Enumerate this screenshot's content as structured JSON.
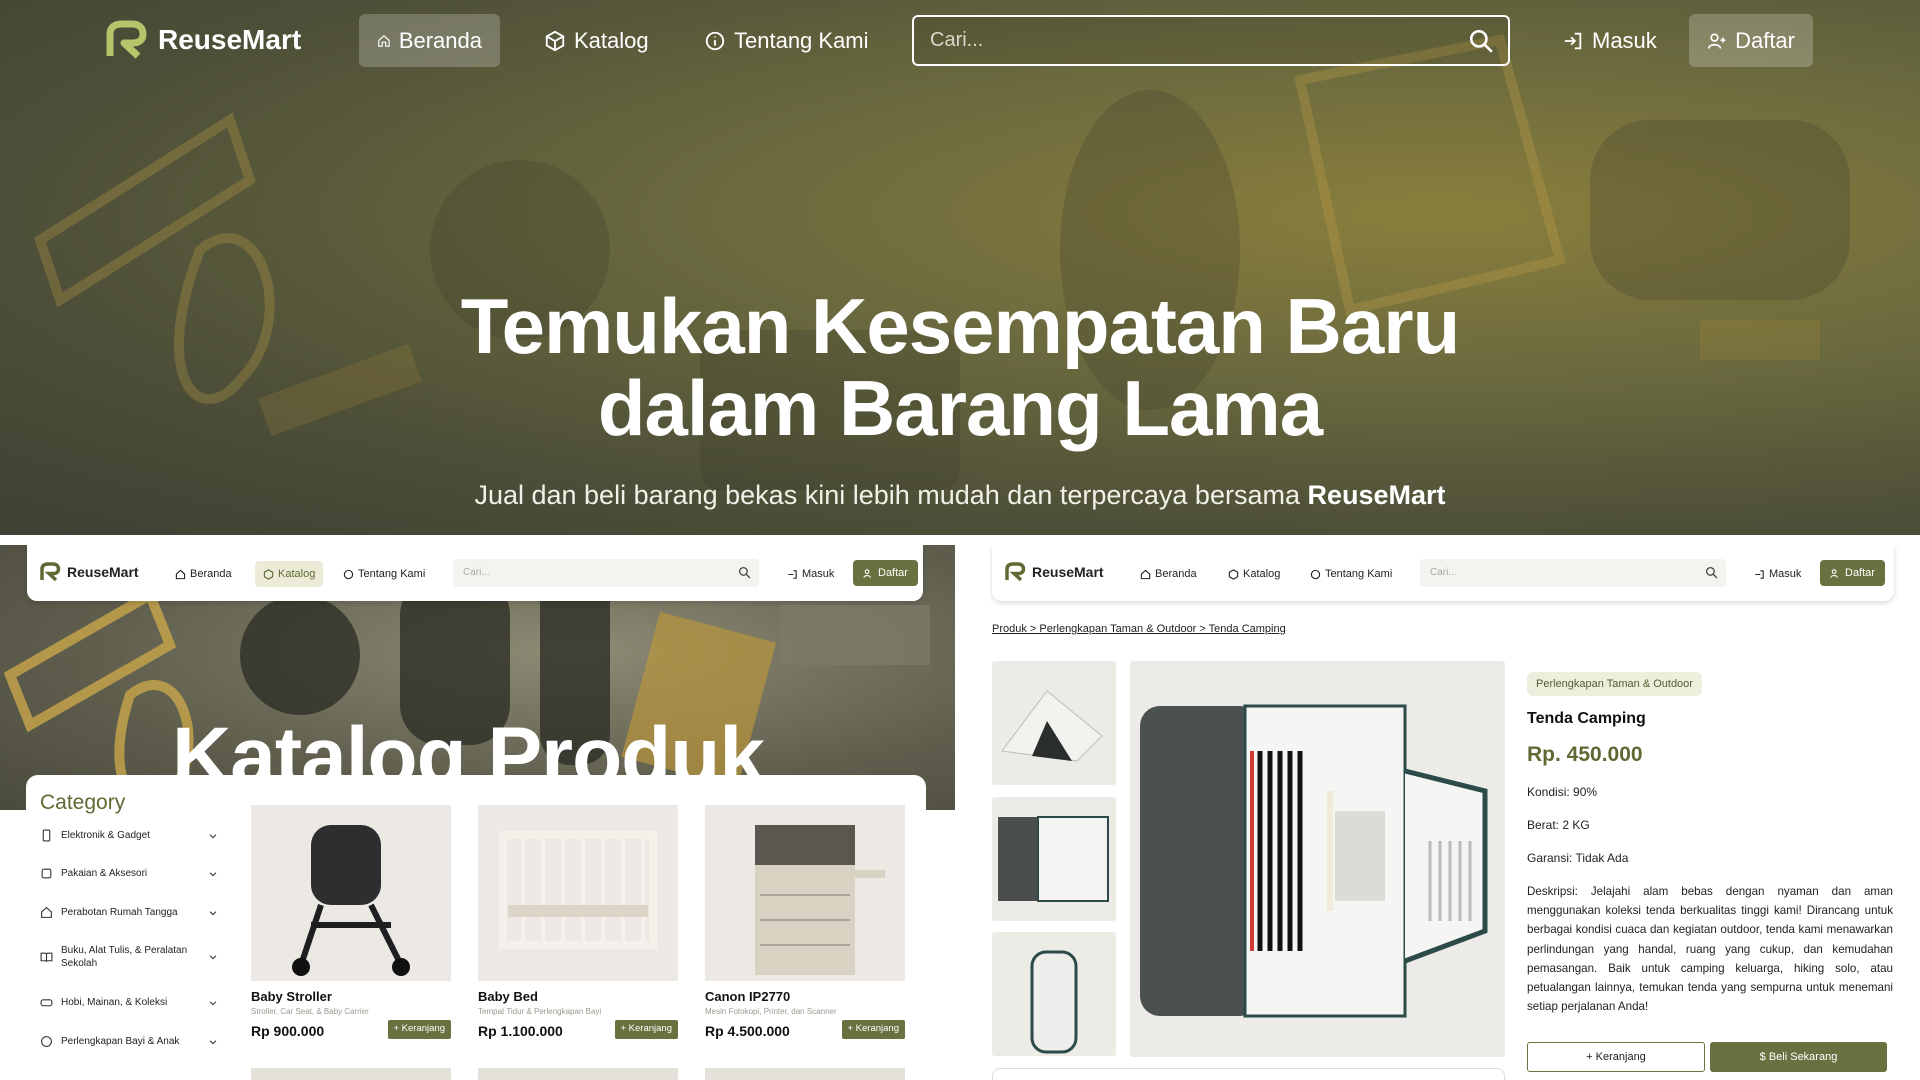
{
  "header": {
    "brand": "ReuseMart",
    "nav": [
      "Beranda",
      "Katalog",
      "Tentang Kami"
    ],
    "search_placeholder": "Cari...",
    "login": "Masuk",
    "register": "Daftar"
  },
  "hero": {
    "title_line1": "Temukan Kesempatan Baru",
    "title_line2": "dalam Barang Lama",
    "subtitle": "Jual dan beli barang bekas kini lebih mudah dan terpercaya bersama",
    "subtitle_brand": "ReuseMart"
  },
  "catalog_preview": {
    "brand": "ReuseMart",
    "nav": [
      "Beranda",
      "Katalog",
      "Tentang Kami"
    ],
    "search_placeholder": "Cari...",
    "login": "Masuk",
    "register": "Daftar",
    "banner_title": "Katalog Produk",
    "category_title": "Category",
    "categories": [
      "Elektronik & Gadget",
      "Pakaian & Aksesori",
      "Perabotan Rumah Tangga",
      "Buku, Alat Tulis, & Peralatan Sekolah",
      "Hobi, Mainan, & Koleksi",
      "Perlengkapan Bayi & Anak"
    ],
    "products": [
      {
        "name": "Baby Stroller",
        "sub": "Stroller, Car Seat, & Baby Carrier",
        "price": "Rp 900.000",
        "cart": "+ Keranjang"
      },
      {
        "name": "Baby Bed",
        "sub": "Tempat Tidur & Perlengkapan Bayi",
        "price": "Rp 1.100.000",
        "cart": "+ Keranjang"
      },
      {
        "name": "Canon IP2770",
        "sub": "Mesin Fotokopi, Printer, dan Scanner",
        "price": "Rp 4.500.000",
        "cart": "+ Keranjang"
      }
    ]
  },
  "detail_preview": {
    "brand": "ReuseMart",
    "nav": [
      "Beranda",
      "Katalog",
      "Tentang Kami"
    ],
    "search_placeholder": "Cari...",
    "login": "Masuk",
    "register": "Daftar",
    "breadcrumb": "Produk > Perlengkapan Taman & Outdoor > Tenda Camping",
    "category_tag": "Perlengkapan Taman & Outdoor",
    "name": "Tenda Camping",
    "price": "Rp. 450.000",
    "condition": "Kondisi: 90%",
    "weight": "Berat: 2 KG",
    "warranty": "Garansi: Tidak Ada",
    "description": "Deskripsi: Jelajahi alam bebas dengan nyaman dan aman menggunakan koleksi tenda berkualitas tinggi kami! Dirancang untuk berbagai kondisi cuaca dan kegiatan outdoor, tenda kami menawarkan perlindungan yang handal, ruang yang cukup, dan kemudahan pemasangan. Baik untuk camping keluarga, hiking solo, atau petualangan lainnya, temukan tenda yang sempurna untuk menemani setiap perjalanan Anda!",
    "add_cart": "+ Keranjang",
    "buy_now": "$ Beli Sekarang"
  },
  "colors": {
    "accent": "#6b7040",
    "accent_text": "#5e6a34",
    "hero_overlay": "#6b6a3e"
  },
  "icons": [
    "home-icon",
    "box-icon",
    "info-icon",
    "search-icon",
    "login-icon",
    "user-plus-icon",
    "chevron-down-icon"
  ]
}
